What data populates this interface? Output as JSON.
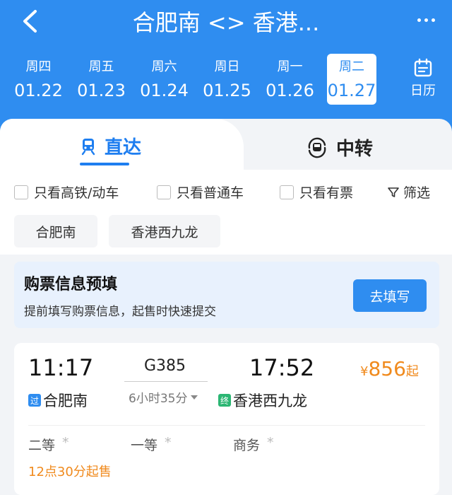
{
  "header": {
    "title": "合肥南 <> 香港...",
    "dates": [
      {
        "weekday": "周四",
        "date": "01.22"
      },
      {
        "weekday": "周五",
        "date": "01.23"
      },
      {
        "weekday": "周六",
        "date": "01.24"
      },
      {
        "weekday": "周日",
        "date": "01.25"
      },
      {
        "weekday": "周一",
        "date": "01.26"
      },
      {
        "weekday": "周二",
        "date": "01.27"
      }
    ],
    "calendar_label": "日历"
  },
  "tabs": {
    "direct": "直达",
    "transfer": "中转"
  },
  "filters": {
    "high_speed": "只看高铁/动车",
    "regular": "只看普通车",
    "available": "只看有票",
    "screen": "筛选"
  },
  "stations": {
    "from": "合肥南",
    "to": "香港西九龙"
  },
  "prefill": {
    "title": "购票信息预填",
    "subtitle": "提前填写购票信息，起售时快速提交",
    "button": "去填写"
  },
  "train": {
    "depart_time": "11:17",
    "arrive_time": "17:52",
    "number": "G385",
    "duration": "6小时35分",
    "currency": "¥",
    "price": "856",
    "price_suffix": "起",
    "from_badge": "过",
    "from_station": "合肥南",
    "to_badge": "终",
    "to_station": "香港西九龙",
    "seat1": "二等",
    "seat2": "一等",
    "seat3": "商务",
    "seat_star": "*",
    "sale_note": "12点30分起售"
  },
  "colors": {
    "primary": "#2f8df0",
    "accent_orange": "#f08a1d",
    "badge_blue": "#2f8df0",
    "badge_green": "#2bb673"
  }
}
